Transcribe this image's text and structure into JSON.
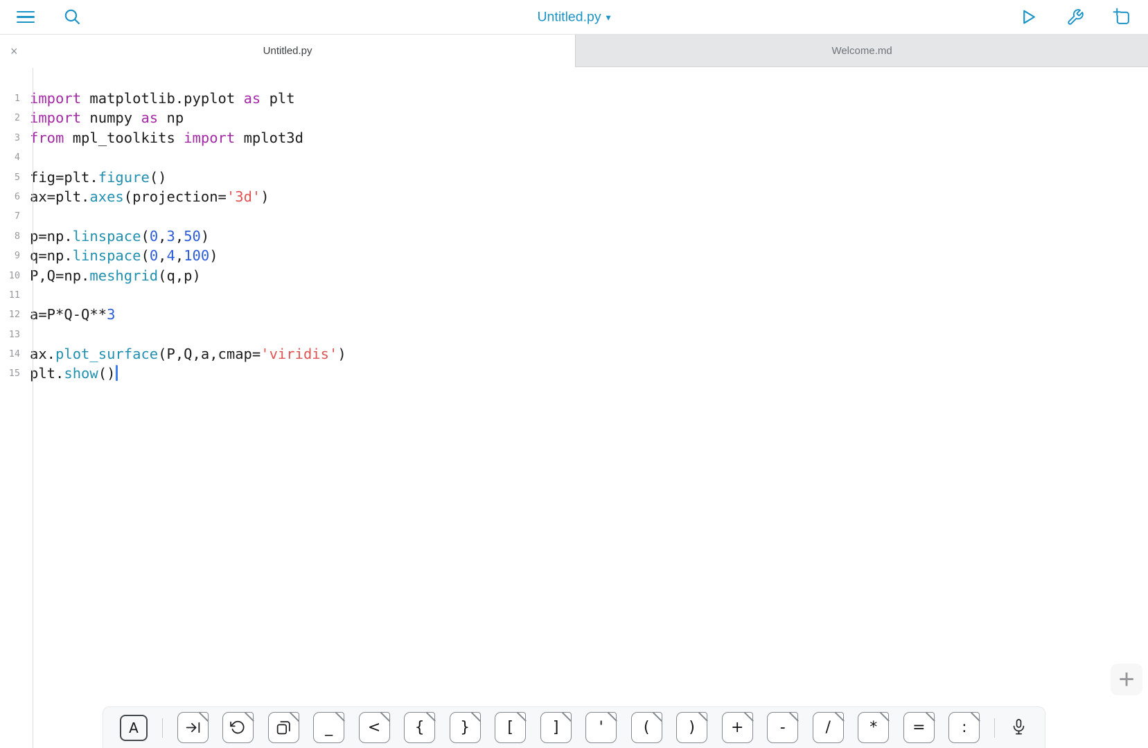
{
  "toolbar": {
    "title": "Untitled.py",
    "caret": "▼"
  },
  "tabs": {
    "close_label": "×",
    "items": [
      {
        "label": "Untitled.py",
        "active": true
      },
      {
        "label": "Welcome.md",
        "active": false
      }
    ]
  },
  "editor": {
    "lines": [
      {
        "n": "1",
        "tokens": [
          [
            "kw",
            "import"
          ],
          [
            "pl",
            " matplotlib.pyplot "
          ],
          [
            "kw",
            "as"
          ],
          [
            "pl",
            " plt"
          ]
        ]
      },
      {
        "n": "2",
        "tokens": [
          [
            "kw",
            "import"
          ],
          [
            "pl",
            " numpy "
          ],
          [
            "kw",
            "as"
          ],
          [
            "pl",
            " np"
          ]
        ]
      },
      {
        "n": "3",
        "tokens": [
          [
            "kw",
            "from"
          ],
          [
            "pl",
            " mpl_toolkits "
          ],
          [
            "kw",
            "import"
          ],
          [
            "pl",
            " mplot3d"
          ]
        ]
      },
      {
        "n": "4",
        "tokens": []
      },
      {
        "n": "5",
        "tokens": [
          [
            "pl",
            "fig=plt."
          ],
          [
            "fn",
            "figure"
          ],
          [
            "pl",
            "()"
          ]
        ]
      },
      {
        "n": "6",
        "tokens": [
          [
            "pl",
            "ax=plt."
          ],
          [
            "fn",
            "axes"
          ],
          [
            "pl",
            "(projection="
          ],
          [
            "str",
            "'3d'"
          ],
          [
            "pl",
            ")"
          ]
        ]
      },
      {
        "n": "7",
        "tokens": []
      },
      {
        "n": "8",
        "tokens": [
          [
            "pl",
            "p=np."
          ],
          [
            "fn",
            "linspace"
          ],
          [
            "pl",
            "("
          ],
          [
            "num",
            "0"
          ],
          [
            "pl",
            ","
          ],
          [
            "num",
            "3"
          ],
          [
            "pl",
            ","
          ],
          [
            "num",
            "50"
          ],
          [
            "pl",
            ")"
          ]
        ]
      },
      {
        "n": "9",
        "tokens": [
          [
            "pl",
            "q=np."
          ],
          [
            "fn",
            "linspace"
          ],
          [
            "pl",
            "("
          ],
          [
            "num",
            "0"
          ],
          [
            "pl",
            ","
          ],
          [
            "num",
            "4"
          ],
          [
            "pl",
            ","
          ],
          [
            "num",
            "100"
          ],
          [
            "pl",
            ")"
          ]
        ]
      },
      {
        "n": "10",
        "tokens": [
          [
            "pl",
            "P,Q=np."
          ],
          [
            "fn",
            "meshgrid"
          ],
          [
            "pl",
            "(q,p)"
          ]
        ]
      },
      {
        "n": "11",
        "tokens": []
      },
      {
        "n": "12",
        "tokens": [
          [
            "pl",
            "a=P*Q-Q**"
          ],
          [
            "num",
            "3"
          ]
        ]
      },
      {
        "n": "13",
        "tokens": []
      },
      {
        "n": "14",
        "tokens": [
          [
            "pl",
            "ax."
          ],
          [
            "fn",
            "plot_surface"
          ],
          [
            "pl",
            "(P,Q,a,cmap="
          ],
          [
            "str",
            "'viridis'"
          ],
          [
            "pl",
            ")"
          ]
        ]
      },
      {
        "n": "15",
        "tokens": [
          [
            "pl",
            "plt."
          ],
          [
            "fn",
            "show"
          ],
          [
            "pl",
            "()"
          ]
        ],
        "cursor": true
      }
    ]
  },
  "keyboard": {
    "keys": [
      {
        "name": "select-key",
        "variant": "boxed",
        "glyph": "A"
      },
      {
        "name": "keyboard-divider",
        "variant": "divider"
      },
      {
        "name": "tab-key",
        "variant": "tab",
        "icon": "tab-arrow-icon"
      },
      {
        "name": "undo-key",
        "variant": "undo",
        "icon": "undo-arrow-icon"
      },
      {
        "name": "copy-key",
        "variant": "copy",
        "icon": "copy-icon"
      },
      {
        "name": "underscore-key",
        "glyph": "_"
      },
      {
        "name": "less-than-key",
        "glyph": "<"
      },
      {
        "name": "open-brace-key",
        "glyph": "{"
      },
      {
        "name": "close-brace-key",
        "glyph": "}"
      },
      {
        "name": "open-bracket-key",
        "glyph": "["
      },
      {
        "name": "close-bracket-key",
        "glyph": "]"
      },
      {
        "name": "apostrophe-key",
        "glyph": "'"
      },
      {
        "name": "open-paren-key",
        "glyph": "("
      },
      {
        "name": "close-paren-key",
        "glyph": ")"
      },
      {
        "name": "plus-key",
        "glyph": "+"
      },
      {
        "name": "minus-key",
        "glyph": "-"
      },
      {
        "name": "slash-key",
        "glyph": "/"
      },
      {
        "name": "asterisk-key",
        "glyph": "*"
      },
      {
        "name": "equals-key",
        "glyph": "="
      },
      {
        "name": "colon-key",
        "glyph": ":"
      },
      {
        "name": "keyboard-divider",
        "variant": "divider"
      },
      {
        "name": "dictation-key",
        "variant": "mic",
        "icon": "microphone-icon"
      }
    ]
  },
  "fab": {
    "plus": "+"
  },
  "colors": {
    "accent": "#1b93c7",
    "keyword": "#a429a6",
    "function": "#2190b0",
    "number": "#2a5cd8",
    "string": "#e05352"
  }
}
